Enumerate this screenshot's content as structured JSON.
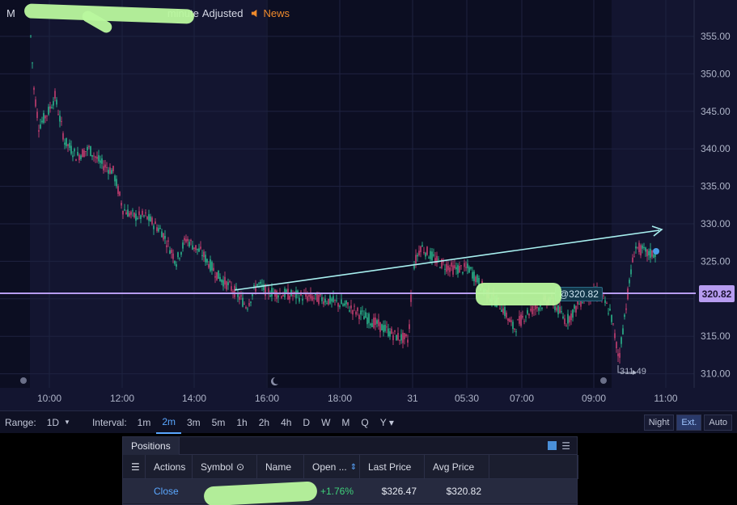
{
  "header": {
    "title_visible": "M",
    "title_suffix": "minute",
    "adjusted_label": "Adjusted",
    "news_label": "News"
  },
  "price_axis": {
    "ticks": [
      "355.00",
      "350.00",
      "345.00",
      "340.00",
      "335.00",
      "330.00",
      "325.00",
      "320.00",
      "315.00",
      "310.00"
    ],
    "current_label": "320.82"
  },
  "time_axis": {
    "ticks": [
      "10:00",
      "12:00",
      "14:00",
      "16:00",
      "18:00",
      "31",
      "05:30",
      "07:00",
      "09:00",
      "11:00"
    ]
  },
  "annotations": {
    "position_tag": "@320.82",
    "low_label": "311.49"
  },
  "toolbar": {
    "range_label": "Range:",
    "range_value": "1D",
    "interval_label": "Interval:",
    "intervals": [
      "1m",
      "2m",
      "3m",
      "5m",
      "1h",
      "2h",
      "4h",
      "D",
      "W",
      "M",
      "Q",
      "Y"
    ],
    "active_interval": "2m",
    "right_buttons": [
      "Night",
      "Ext.",
      "Auto"
    ]
  },
  "positions": {
    "tab_label": "Positions",
    "columns": [
      "Actions",
      "Symbol",
      "Name",
      "Open ...",
      "Last Price",
      "Avg Price"
    ],
    "row": {
      "action": "Close",
      "open_pl": "+1.76%",
      "last_price": "$326.47",
      "avg_price": "$320.82"
    }
  },
  "colors": {
    "background": "#131530",
    "up_candle": "#2ecc9a",
    "down_candle": "#e0457b",
    "trend_line": "#a8f0f0",
    "horizontal_line": "#b79cf0",
    "accent": "#5aa7ff"
  }
}
